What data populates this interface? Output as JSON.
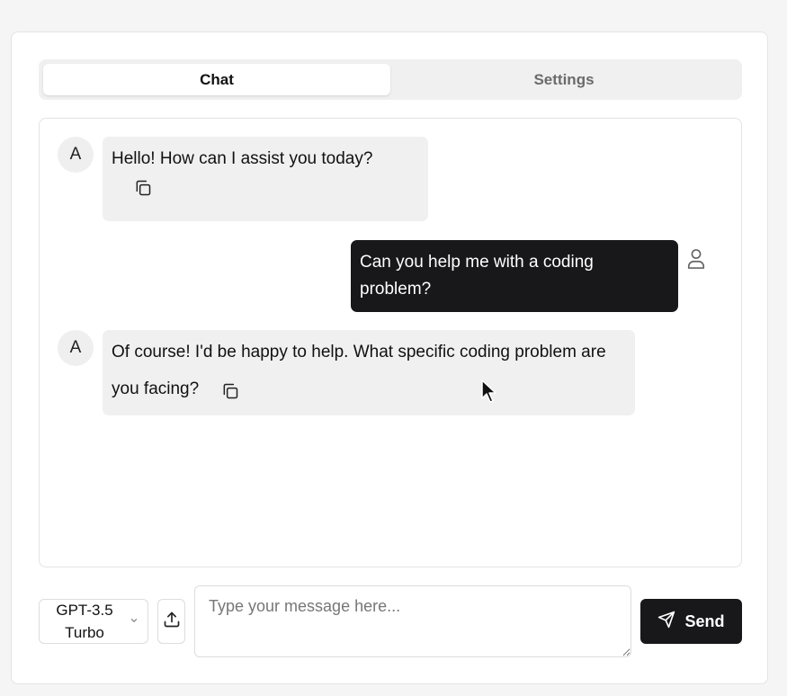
{
  "tabs": [
    {
      "label": "Chat",
      "active": true
    },
    {
      "label": "Settings",
      "active": false
    }
  ],
  "messages": [
    {
      "role": "assistant",
      "avatar": "A",
      "text": "Hello! How can I assist you today?",
      "icon": "copy-icon"
    },
    {
      "role": "user",
      "text": "Can you help me with a coding problem?",
      "icon": "user-icon"
    },
    {
      "role": "assistant",
      "avatar": "A",
      "text": "Of course! I'd be happy to help. What specific coding problem are you facing?",
      "icon": "copy-icon"
    }
  ],
  "composer": {
    "model": "GPT-3.5 Turbo",
    "placeholder": "Type your message here...",
    "value": "",
    "send_label": "Send",
    "upload_icon": "upload-icon",
    "send_icon": "send-icon"
  },
  "colors": {
    "primary": "#18181a",
    "assistant_bubble": "#f0f0f0",
    "border": "#e3e3e3"
  }
}
